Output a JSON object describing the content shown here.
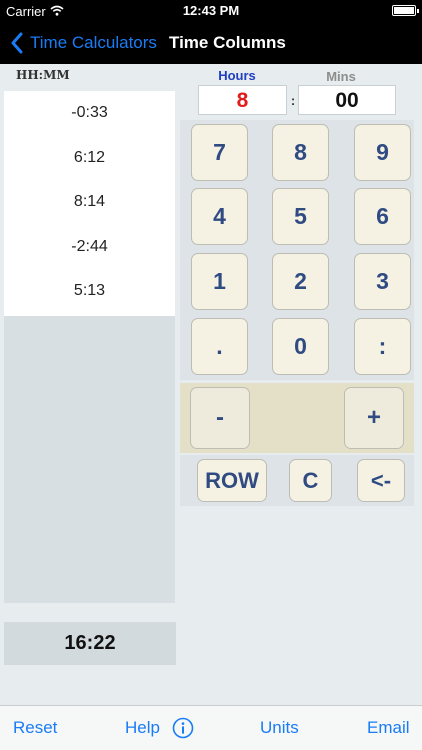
{
  "status_bar": {
    "carrier": "Carrier",
    "time": "12:43 PM"
  },
  "nav": {
    "back_label": "Time Calculators",
    "title": "Time Columns"
  },
  "column": {
    "header": "HH:MM",
    "entries": [
      "-0:33",
      "6:12",
      "8:14",
      "-2:44",
      "5:13"
    ],
    "total": "16:22"
  },
  "input": {
    "hours_label": "Hours",
    "mins_label": "Mins",
    "hours_value": "8",
    "separator": ":",
    "mins_value": "00"
  },
  "keypad": {
    "keys": [
      "7",
      "8",
      "9",
      "4",
      "5",
      "6",
      "1",
      "2",
      "3",
      ".",
      "0",
      ":"
    ],
    "minus": "-",
    "plus": "+",
    "row": "ROW",
    "clear": "C",
    "backspace": "<-"
  },
  "toolbar": {
    "reset": "Reset",
    "help": "Help",
    "units": "Units",
    "email": "Email"
  },
  "colors": {
    "accent": "#1a7cf5",
    "hours_value": "#e21b1b",
    "hours_label": "#1f3fbf",
    "key_face": "#f5f2e4",
    "key_text": "#2f4b82"
  }
}
